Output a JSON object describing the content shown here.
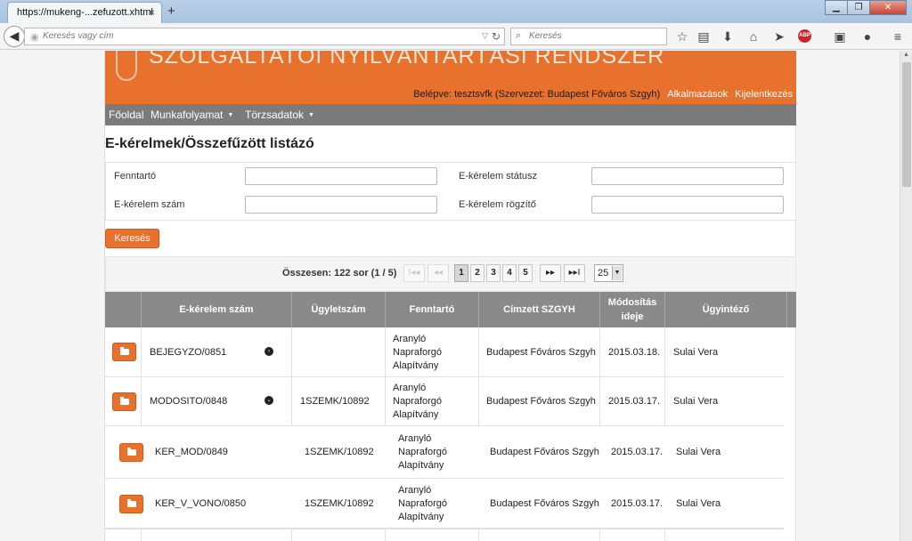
{
  "browser": {
    "tab_title": "https://mukeng-...zefuzott.xhtml",
    "tab_close": "×",
    "new_tab": "+",
    "url_placeholder": "Keresés vagy cím",
    "search_placeholder": "Keresés",
    "window_buttons": {
      "minimize": "▁",
      "restore": "❐",
      "close": "✕"
    }
  },
  "header": {
    "system_title": "SZOLGÁLTATÓI NYILVÁNTARTÁSI RENDSZER",
    "login_text": "Belépve: tesztsvfk (Szervezet: Budapest Főváros Szgyh)",
    "apps_link": "Alkalmazások",
    "logout_link": "Kijelentkezés",
    "accent_color": "#e8712e"
  },
  "menu": {
    "items": [
      {
        "label": "Főoldal"
      },
      {
        "label": "Munkafolyamat"
      },
      {
        "label": "Törzsadatok"
      }
    ]
  },
  "page": {
    "title": "E-kérelmek/Összefűzött listázó"
  },
  "filters": {
    "fenntarto": {
      "label": "Fenntartó",
      "value": ""
    },
    "statusz": {
      "label": "E-kérelem státusz",
      "value": ""
    },
    "szam": {
      "label": "E-kérelem szám",
      "value": ""
    },
    "rogzito": {
      "label": "E-kérelem rögzítő",
      "value": ""
    },
    "search_button": "Keresés"
  },
  "pager": {
    "total": "Összesen: 122 sor (1 / 5)",
    "first": "I◂◂",
    "prev": "◂◂",
    "pages": [
      "1",
      "2",
      "3",
      "4",
      "5"
    ],
    "current_page": "1",
    "next": "▸▸",
    "last": "▸▸I",
    "page_size": "25"
  },
  "table": {
    "headers": [
      "E-kérelem szám",
      "Ügyletszám",
      "Fenntartó",
      "Címzett SZGYH",
      "Módosítás ideje",
      "Ügyintéző"
    ],
    "rows": [
      {
        "szam": "BEJEGYZO/0851",
        "ugyletszam": "",
        "fenntarto": "Aranyló Napraforgó Alapítvány",
        "cimzett": "Budapest Főváros Szgyh",
        "modositas": "2015.03.18.",
        "ugyintezo": "Sulai Vera",
        "toggle": "›"
      },
      {
        "szam": "MODOSITO/0848",
        "ugyletszam": "1SZEMK/10892",
        "fenntarto": "Aranyló Napraforgó Alapítvány",
        "cimzett": "Budapest Főváros Szgyh",
        "modositas": "2015.03.17.",
        "ugyintezo": "Sulai Vera",
        "toggle": "⌄"
      }
    ],
    "child_rows": [
      {
        "szam": "KER_MOD/0849",
        "ugyletszam": "1SZEMK/10892",
        "fenntarto": "Aranyló Napraforgó Alapítvány",
        "cimzett": "Budapest Főváros Szgyh",
        "modositas": "2015.03.17.",
        "ugyintezo": "Sulai Vera"
      },
      {
        "szam": "KER_V_VONO/0850",
        "ugyletszam": "1SZEMK/10892",
        "fenntarto": "Aranyló Napraforgó Alapítvány",
        "cimzett": "Budapest Főváros Szgyh",
        "modositas": "2015.03.17.",
        "ugyintezo": "Sulai Vera"
      }
    ]
  }
}
